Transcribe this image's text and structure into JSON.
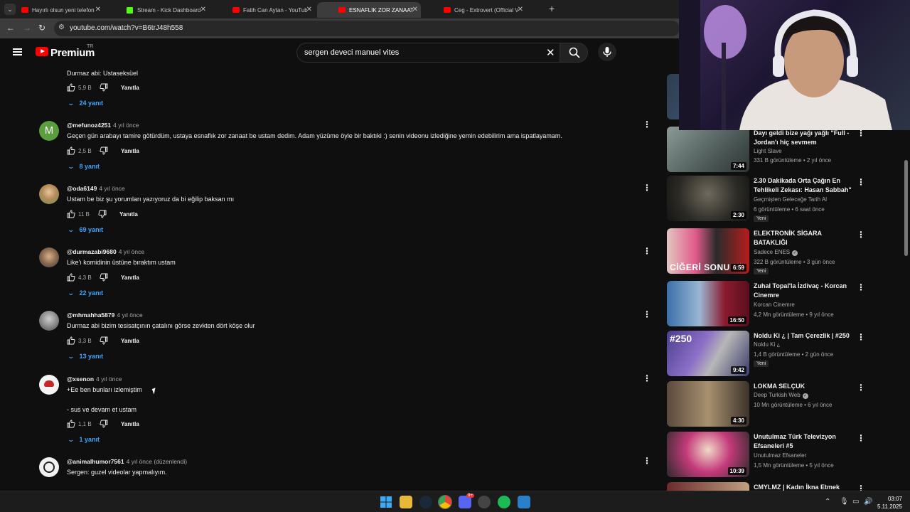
{
  "browser": {
    "tabs": [
      {
        "label": "Hayırlı olsun yeni telefon #ebo",
        "icon": "youtube-icon",
        "active": false
      },
      {
        "label": "Stream - Kick Dashboard",
        "icon": "kick-icon",
        "active": false
      },
      {
        "label": "Fatih Can Aytan - YouTube",
        "icon": "youtube-icon",
        "active": false
      },
      {
        "label": "ESNAFLIK ZOR ZANAAT SERİSİ",
        "icon": "youtube-icon",
        "active": true
      },
      {
        "label": "Ceg - Extrovert (Official Video)",
        "icon": "youtube-icon",
        "active": false
      }
    ],
    "url": "youtube.com/watch?v=B6trJ48h558"
  },
  "header": {
    "brand": "Premium",
    "region": "TR",
    "search_query": "sergen deveci manuel vites"
  },
  "comments": [
    {
      "author": "",
      "age": "",
      "text": "Durmaz abi: Ustaseksüel",
      "likes": "5,9 B",
      "reply_label": "Yanıtla",
      "replies": "24 yanıt"
    },
    {
      "author": "@mefunoz4251",
      "age": "4 yıl önce",
      "avatar_letter": "M",
      "text": "Geçen gün arabayı tamire götürdüm, ustaya esnaflık zor zanaat be ustam dedim. Adam yüzüme öyle bir baktıki :) senin videonu izlediğine yemin edebilirim ama ispatlayamam.",
      "likes": "2,5 B",
      "reply_label": "Yanıtla",
      "replies": "8 yanıt"
    },
    {
      "author": "@oda6149",
      "age": "4 yıl önce",
      "text": "Ustam be biz şu yorumları yazıyoruz da bi eğilip baksan mı",
      "likes": "11 B",
      "reply_label": "Yanıtla",
      "replies": "69 yanıt"
    },
    {
      "author": "@durmazabi9680",
      "age": "4 yıl önce",
      "text": "Like'ı komidinin üstüne bıraktım ustam",
      "likes": "4,3 B",
      "reply_label": "Yanıtla",
      "replies": "22 yanıt"
    },
    {
      "author": "@mhmahha5879",
      "age": "4 yıl önce",
      "text": "Durmaz abi bizim tesisatçının çatalını görse zevkten dört köşe olur",
      "likes": "3,3 B",
      "reply_label": "Yanıtla",
      "replies": "13 yanıt"
    },
    {
      "author": "@xsenon",
      "age": "4 yıl önce",
      "text": "+Ee ben bunları izlemiştim",
      "text2": "- sus ve devam et ustam",
      "likes": "1,1 B",
      "reply_label": "Yanıtla",
      "replies": "1 yanıt"
    },
    {
      "author": "@animalhumor7561",
      "age": "4 yıl önce (düzenlendi)",
      "text": "Sergen: guzel videolar yapmalıyım."
    }
  ],
  "recommendations": [
    {
      "title": "Dayı geldi bize yağı yağlı \"Full - Jordan'ı hiç sevmem",
      "channel": "Light Slave",
      "meta": "331 B görüntüleme • 2 yıl önce",
      "duration": "7:44"
    },
    {
      "title": "2.30 Dakikada Orta Çağın En Tehlikeli Zekası: Hasan Sabbah\"",
      "channel": "Geçmişten Geleceğe Tarih Al",
      "meta": "6 görüntüleme • 6 saat önce",
      "duration": "2:30",
      "badge": "Yeni"
    },
    {
      "title": "ELEKTRONİK SİGARA BATAKLIĞI",
      "channel": "Sadece ENES",
      "verified": true,
      "meta": "322 B görüntüleme • 3 gün önce",
      "duration": "6:59",
      "badge": "Yeni",
      "thumb_text": "CİĞERİ SONU"
    },
    {
      "title": "Zuhal Topal'la İzdivaç - Korcan Cinemre",
      "channel": "Korcan Cinemre",
      "meta": "4,2 Mn görüntüleme • 9 yıl önce",
      "duration": "16:50"
    },
    {
      "title": "Noldu Ki ¿ | Tam Çerezlik | #250",
      "channel": "Noldu Ki ¿",
      "meta": "1,4 B görüntüleme • 2 gün önce",
      "duration": "9:42",
      "badge": "Yeni",
      "thumb_text": "#250"
    },
    {
      "title": "LOKMA SELÇUK",
      "channel": "Deep Turkish Web",
      "verified": true,
      "meta": "10 Mn görüntüleme • 6 yıl önce",
      "duration": "4:30"
    },
    {
      "title": "Unutulmaz Türk Televizyon Efsaneleri #5",
      "channel": "Unutulmaz Efsaneler",
      "meta": "1,5 Mn görüntüleme • 5 yıl önce",
      "duration": "10:39"
    },
    {
      "title": "CMYLMZ | Kadın İkna Etmek"
    }
  ],
  "taskbar": {
    "time": "03:07",
    "date": "5.11.2025",
    "discord_badge": "9+"
  },
  "colors": {
    "background": "#0f0f0f",
    "accent_blue": "#3ea6ff",
    "youtube_red": "#ff0000"
  }
}
